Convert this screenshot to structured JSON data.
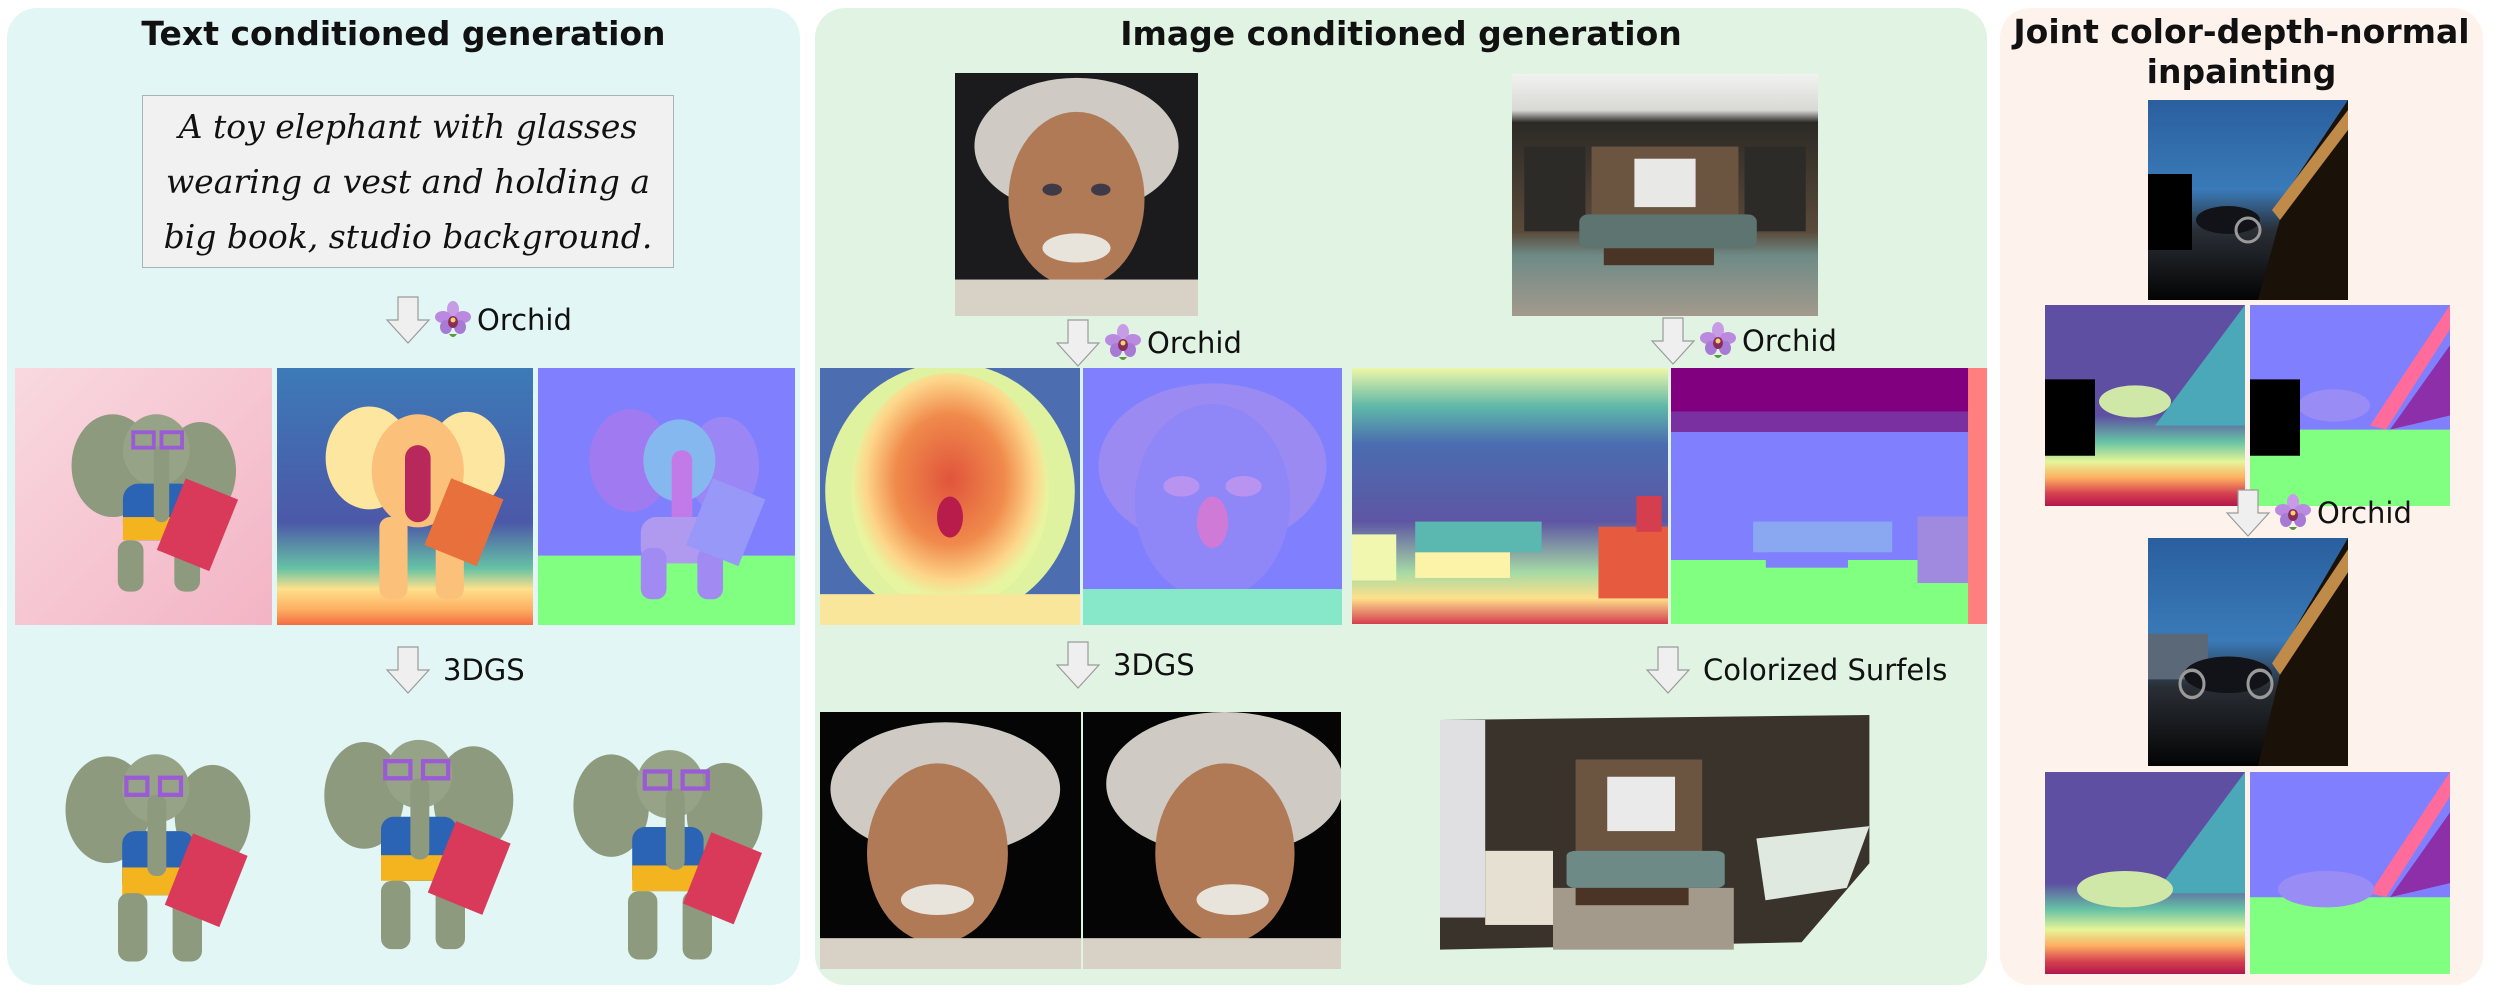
{
  "panels": {
    "text": {
      "title": "Text conditioned generation",
      "prompt": "A toy elephant with glasses wearing a vest and holding a big book, studio background.",
      "steps": [
        "Orchid",
        "3DGS"
      ],
      "outputs": [
        "color-image",
        "depth-map",
        "normal-map"
      ],
      "renders": [
        "3dgs-view-1",
        "3dgs-view-2",
        "3dgs-view-3"
      ]
    },
    "image": {
      "title": "Image conditioned generation",
      "inputs": [
        "portrait-input",
        "living-room-input"
      ],
      "steps_left": [
        "Orchid",
        "3DGS"
      ],
      "steps_right": [
        "Orchid",
        "Colorized Surfels"
      ],
      "outputs_left": [
        "portrait-depth-map",
        "portrait-normal-map"
      ],
      "outputs_right": [
        "room-depth-map",
        "room-normal-map"
      ],
      "renders_left": [
        "portrait-3dgs-view-1",
        "portrait-3dgs-view-2"
      ],
      "renders_right": [
        "room-colorized-surfels"
      ]
    },
    "joint": {
      "title_line1": "Joint color-depth-normal",
      "title_line2": "inpainting",
      "step": "Orchid",
      "inputs": [
        "masked-color-image",
        "masked-depth-map",
        "masked-normal-map"
      ],
      "outputs": [
        "inpainted-color-image",
        "inpainted-depth-map",
        "inpainted-normal-map"
      ]
    }
  },
  "colors": {
    "panel_text_bg": "#e1f6f5",
    "panel_image_bg": "#e1f4e3",
    "panel_joint_bg": "#fdf3ec",
    "prompt_box_bg": "#f1f1f1",
    "normal_bg": "#8080ff",
    "normal_floor": "#80ff80"
  }
}
